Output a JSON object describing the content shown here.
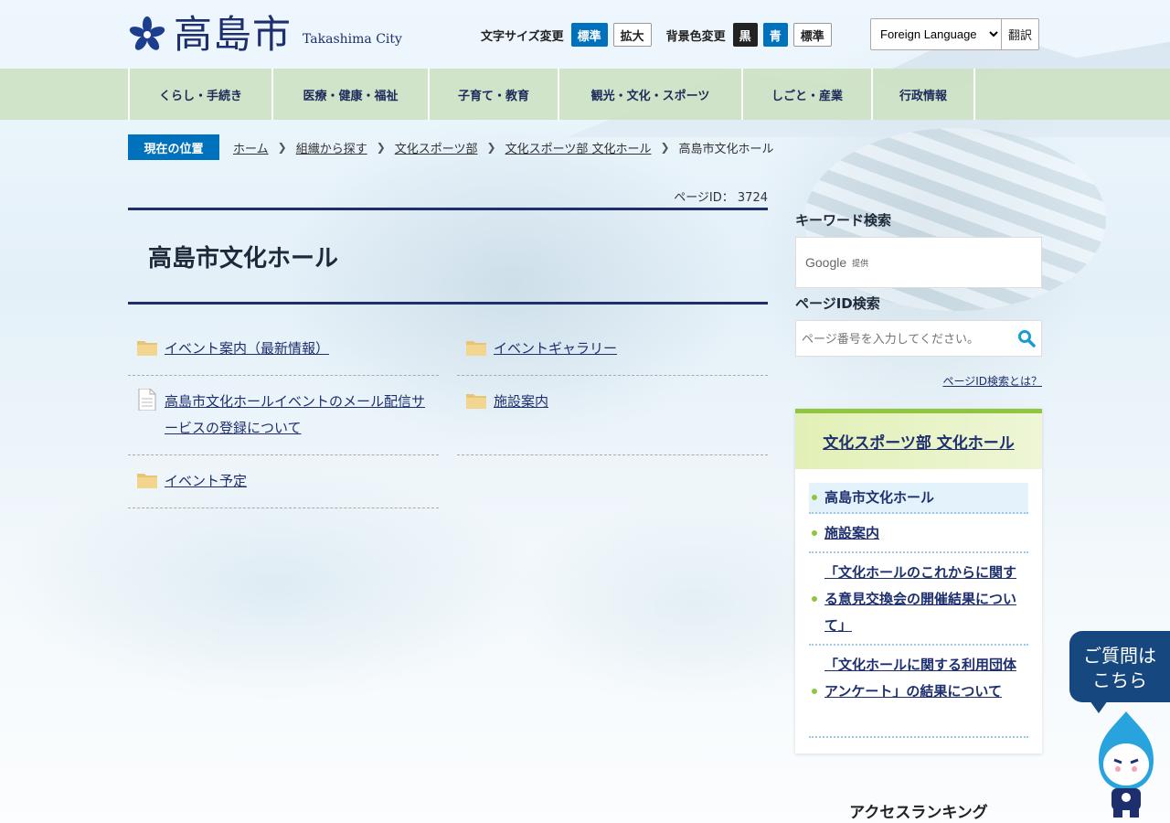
{
  "header": {
    "logo_kanji": "高島市",
    "logo_en": "Takashima City",
    "font_size_label": "文字サイズ変更",
    "font_size_standard": "標準",
    "font_size_large": "拡大",
    "bg_color_label": "背景色変更",
    "bg_black": "黒",
    "bg_blue": "青",
    "bg_standard": "標準",
    "language_selected": "Foreign Language",
    "translate_label": "翻訳"
  },
  "global_nav": [
    "くらし・手続き",
    "医療・健康・福祉",
    "子育て・教育",
    "観光・文化・スポーツ",
    "しごと・産業",
    "行政情報"
  ],
  "breadcrumb": {
    "here_label": "現在の位置",
    "items": [
      "ホーム",
      "組織から探す",
      "文化スポーツ部",
      "文化スポーツ部 文化ホール"
    ],
    "current": "高島市文化ホール"
  },
  "page": {
    "id_text": "ページID： 3724",
    "title": "高島市文化ホール"
  },
  "links": [
    {
      "label": "イベント案内（最新情報）",
      "icon": "folder-icon"
    },
    {
      "label": "イベントギャラリー",
      "icon": "folder-icon"
    },
    {
      "label": "高島市文化ホールイベントのメール配信サービスの登録について",
      "icon": "document-icon"
    },
    {
      "label": "施設案内",
      "icon": "folder-icon"
    },
    {
      "label": "イベント予定",
      "icon": "folder-icon"
    }
  ],
  "sidebar": {
    "keyword_search_title": "キーワード検索",
    "google_label": "Google",
    "google_sub": "提供",
    "pageid_search_title": "ページID検索",
    "pageid_placeholder": "ページ番号を入力してください。",
    "pageid_help": "ページID検索とは？",
    "subnav_title": "文化スポーツ部 文化ホール",
    "subnav_items": [
      "高島市文化ホール",
      "施設案内",
      "「文化ホールのこれからに関する意見交換会の開催結果について」",
      "「文化ホールに関する利用団体アンケート」の結果について"
    ],
    "ranking_title": "アクセスランキング"
  },
  "chat": {
    "line1": "ご質問は",
    "line2": "こちら"
  },
  "colors": {
    "brand_navy": "#1e2f6e",
    "accent_blue": "#0071bc",
    "nav_green": "#cde2c4",
    "subnav_green": "#8ec63f"
  }
}
